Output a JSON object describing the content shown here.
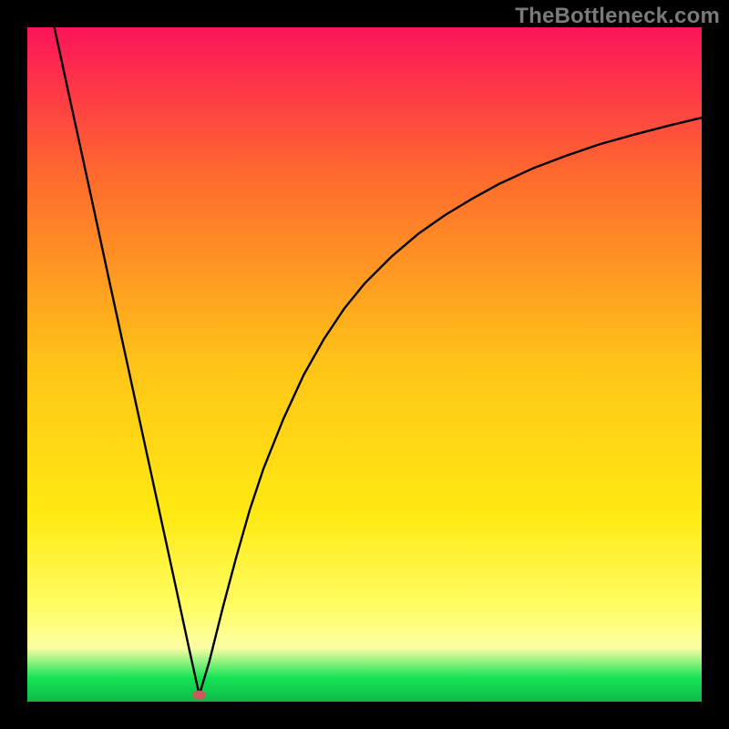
{
  "watermark": "TheBottleneck.com",
  "colors": {
    "frame": "#000000",
    "gradient_top": "#fc1459",
    "gradient_upper": "#ff6a2e",
    "gradient_mid": "#ffc418",
    "gradient_lower_mid": "#ffe912",
    "gradient_lower": "#fffd63",
    "gradient_bottom_band": "#fdfda4",
    "gradient_green": "#14e455",
    "gradient_bottom_edge": "#10b948",
    "curve": "#000000",
    "marker": "#d0585d"
  },
  "chart_data": {
    "type": "line",
    "title": "",
    "xlabel": "",
    "ylabel": "",
    "xlim": [
      0,
      100
    ],
    "ylim": [
      0,
      100
    ],
    "marker": {
      "x": 25.5,
      "y": 1.0
    },
    "series": [
      {
        "name": "left-segment",
        "x": [
          4.0,
          6.0,
          8.0,
          10.0,
          12.0,
          14.0,
          16.0,
          18.0,
          20.0,
          22.0,
          24.0,
          25.5
        ],
        "values": [
          100.0,
          90.8,
          81.6,
          72.4,
          63.1,
          53.9,
          44.7,
          35.5,
          26.3,
          17.1,
          7.8,
          1.0
        ]
      },
      {
        "name": "right-segment",
        "x": [
          25.5,
          27.0,
          29.0,
          31.0,
          33.0,
          35.0,
          38.0,
          41.0,
          44.0,
          47.0,
          50.0,
          54.0,
          58.0,
          62.0,
          66.0,
          70.0,
          75.0,
          80.0,
          85.0,
          90.0,
          95.0,
          100.0
        ],
        "values": [
          1.0,
          6.0,
          14.0,
          21.5,
          28.5,
          34.5,
          42.0,
          48.5,
          53.8,
          58.3,
          62.0,
          66.0,
          69.4,
          72.2,
          74.6,
          76.8,
          79.1,
          81.0,
          82.7,
          84.1,
          85.4,
          86.6
        ]
      }
    ]
  }
}
